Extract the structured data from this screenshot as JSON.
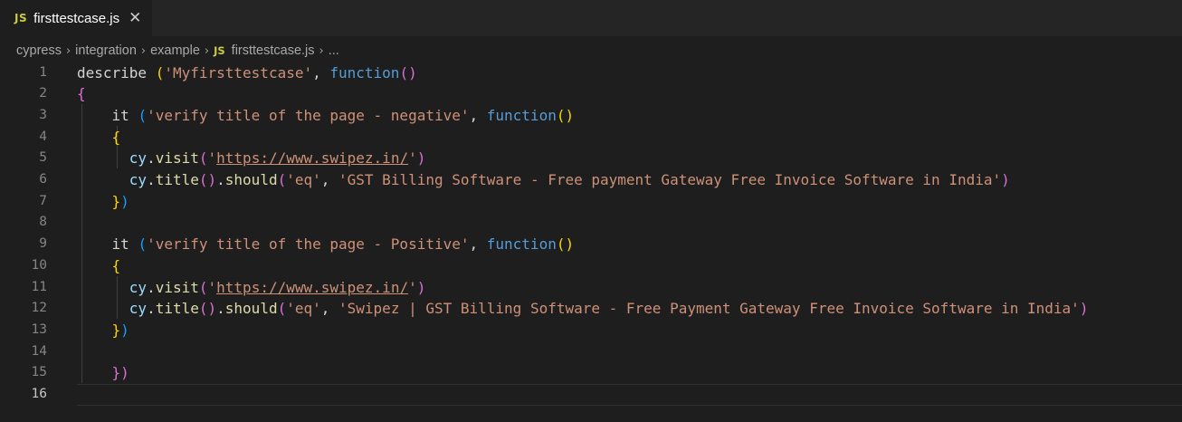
{
  "tab": {
    "badge": "JS",
    "title": "firsttestcase.js",
    "close": "✕"
  },
  "breadcrumb": {
    "items": [
      "cypress",
      "integration",
      "example"
    ],
    "file_badge": "JS",
    "file": "firsttestcase.js",
    "more": "..."
  },
  "editor": {
    "active_line": 16,
    "lines": [
      {
        "n": 1,
        "tokens": [
          [
            "describe ",
            "plain"
          ],
          [
            "(",
            "b1"
          ],
          [
            "'Myfirsttestcase'",
            "str"
          ],
          [
            ", ",
            "plain"
          ],
          [
            "function",
            "kw"
          ],
          [
            "()",
            "b2"
          ]
        ]
      },
      {
        "n": 2,
        "tokens": [
          [
            "{",
            "b2"
          ]
        ]
      },
      {
        "n": 3,
        "tokens": [
          [
            "    it ",
            "plain"
          ],
          [
            "(",
            "b3"
          ],
          [
            "'verify title of the page - negative'",
            "str"
          ],
          [
            ", ",
            "plain"
          ],
          [
            "function",
            "kw"
          ],
          [
            "()",
            "b1"
          ]
        ]
      },
      {
        "n": 4,
        "tokens": [
          [
            "    ",
            "plain"
          ],
          [
            "{",
            "b1"
          ]
        ]
      },
      {
        "n": 5,
        "tokens": [
          [
            "      ",
            "plain"
          ],
          [
            "cy",
            "var"
          ],
          [
            ".",
            "plain"
          ],
          [
            "visit",
            "fn"
          ],
          [
            "(",
            "b2"
          ],
          [
            "'",
            "str"
          ],
          [
            "https://www.swipez.in/",
            "url"
          ],
          [
            "'",
            "str"
          ],
          [
            ")",
            "b2"
          ]
        ]
      },
      {
        "n": 6,
        "tokens": [
          [
            "      ",
            "plain"
          ],
          [
            "cy",
            "var"
          ],
          [
            ".",
            "plain"
          ],
          [
            "title",
            "fn"
          ],
          [
            "()",
            "b2"
          ],
          [
            ".",
            "plain"
          ],
          [
            "should",
            "fn"
          ],
          [
            "(",
            "b2"
          ],
          [
            "'eq'",
            "str"
          ],
          [
            ", ",
            "plain"
          ],
          [
            "'GST Billing Software - Free payment Gateway Free Invoice Software in India'",
            "str"
          ],
          [
            ")",
            "b2"
          ]
        ]
      },
      {
        "n": 7,
        "tokens": [
          [
            "    ",
            "plain"
          ],
          [
            "}",
            "b1"
          ],
          [
            ")",
            "b3"
          ]
        ]
      },
      {
        "n": 8,
        "tokens": []
      },
      {
        "n": 9,
        "tokens": [
          [
            "    it ",
            "plain"
          ],
          [
            "(",
            "b3"
          ],
          [
            "'verify title of the page - Positive'",
            "str"
          ],
          [
            ", ",
            "plain"
          ],
          [
            "function",
            "kw"
          ],
          [
            "()",
            "b1"
          ]
        ]
      },
      {
        "n": 10,
        "tokens": [
          [
            "    ",
            "plain"
          ],
          [
            "{",
            "b1"
          ]
        ]
      },
      {
        "n": 11,
        "tokens": [
          [
            "      ",
            "plain"
          ],
          [
            "cy",
            "var"
          ],
          [
            ".",
            "plain"
          ],
          [
            "visit",
            "fn"
          ],
          [
            "(",
            "b2"
          ],
          [
            "'",
            "str"
          ],
          [
            "https://www.swipez.in/",
            "url"
          ],
          [
            "'",
            "str"
          ],
          [
            ")",
            "b2"
          ]
        ]
      },
      {
        "n": 12,
        "tokens": [
          [
            "      ",
            "plain"
          ],
          [
            "cy",
            "var"
          ],
          [
            ".",
            "plain"
          ],
          [
            "title",
            "fn"
          ],
          [
            "()",
            "b2"
          ],
          [
            ".",
            "plain"
          ],
          [
            "should",
            "fn"
          ],
          [
            "(",
            "b2"
          ],
          [
            "'eq'",
            "str"
          ],
          [
            ", ",
            "plain"
          ],
          [
            "'Swipez | GST Billing Software - Free Payment Gateway Free Invoice Software in India'",
            "str"
          ],
          [
            ")",
            "b2"
          ]
        ]
      },
      {
        "n": 13,
        "tokens": [
          [
            "    ",
            "plain"
          ],
          [
            "}",
            "b1"
          ],
          [
            ")",
            "b3"
          ]
        ]
      },
      {
        "n": 14,
        "tokens": []
      },
      {
        "n": 15,
        "tokens": [
          [
            "    ",
            "plain"
          ],
          [
            "})",
            "b2"
          ]
        ]
      },
      {
        "n": 16,
        "tokens": []
      }
    ]
  }
}
